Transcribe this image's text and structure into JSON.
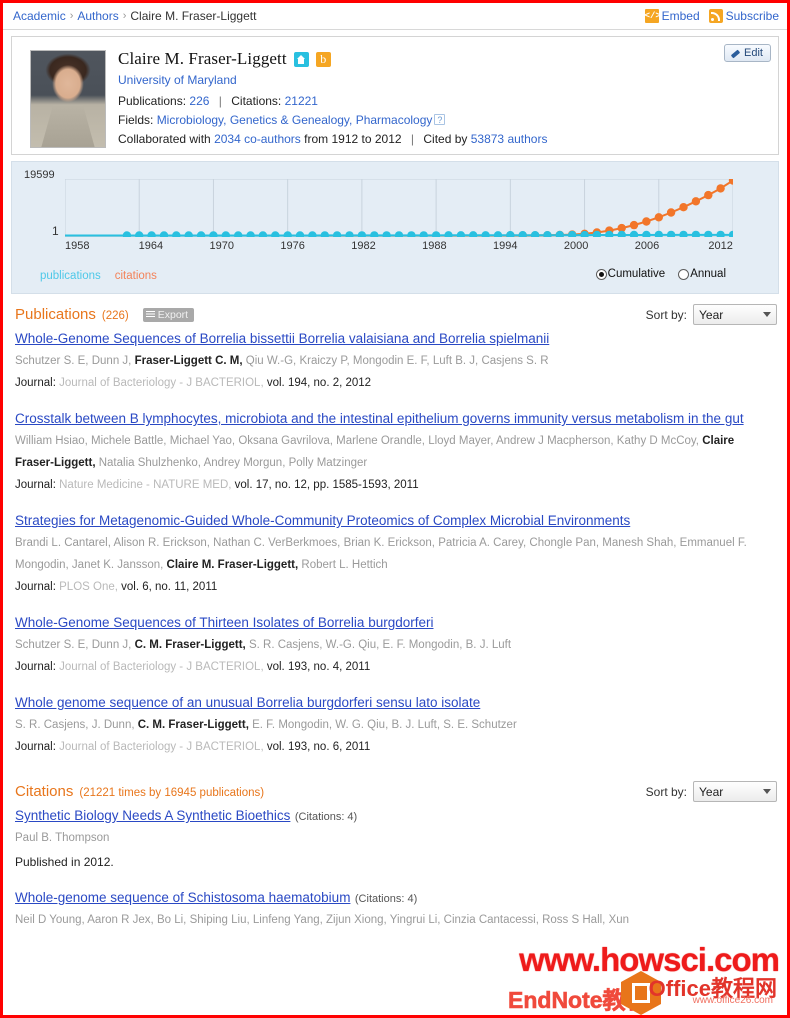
{
  "breadcrumb": {
    "items": [
      "Academic",
      "Authors"
    ],
    "current": "Claire M. Fraser-Liggett",
    "separator": "›"
  },
  "topbar": {
    "embed_label": "Embed",
    "embed_icon": "code-icon",
    "subscribe_label": "Subscribe",
    "subscribe_icon": "rss-icon"
  },
  "profile": {
    "name": "Claire M. Fraser-Liggett",
    "home_icon": "home-icon",
    "bing_icon": "bing-b-icon",
    "affiliation": "University of Maryland",
    "publications_label": "Publications:",
    "publications_count": "226",
    "citations_label": "Citations:",
    "citations_count": "21221",
    "fields_label": "Fields:",
    "fields": [
      "Microbiology,",
      "Genetics & Genealogy,",
      "Pharmacology"
    ],
    "fields_help_icon": "question-mark-icon",
    "collab_prefix": "Collaborated with",
    "collab_link": "2034 co-authors",
    "collab_range": "from 1912 to 2012",
    "cited_prefix": "Cited by",
    "cited_link": "53873 authors",
    "edit_label": "Edit",
    "edit_icon": "pencil-icon",
    "avatar": "author-portrait"
  },
  "chart_data": {
    "type": "line",
    "title": "",
    "xlabel": "",
    "ylabel": "",
    "ylim": [
      1,
      19599
    ],
    "y_tick_labels": [
      "19599",
      "1"
    ],
    "x_tick_labels": [
      "1958",
      "1964",
      "1970",
      "1976",
      "1982",
      "1988",
      "1994",
      "2000",
      "2006",
      "2012"
    ],
    "xlim": [
      1958,
      2012
    ],
    "grid": true,
    "legend_position": "bottom-left",
    "mode_selected": "Cumulative",
    "modes": [
      "Cumulative",
      "Annual"
    ],
    "x": [
      1958,
      1959,
      1960,
      1961,
      1962,
      1963,
      1964,
      1965,
      1966,
      1967,
      1968,
      1969,
      1970,
      1971,
      1972,
      1973,
      1974,
      1975,
      1976,
      1977,
      1978,
      1979,
      1980,
      1981,
      1982,
      1983,
      1984,
      1985,
      1986,
      1987,
      1988,
      1989,
      1990,
      1991,
      1992,
      1993,
      1994,
      1995,
      1996,
      1997,
      1998,
      1999,
      2000,
      2001,
      2002,
      2003,
      2004,
      2005,
      2006,
      2007,
      2008,
      2009,
      2010,
      2011,
      2012
    ],
    "series": [
      {
        "name": "publications",
        "color": "#29c0e0",
        "values": [
          0,
          0,
          0,
          0,
          0,
          1,
          1,
          2,
          2,
          3,
          3,
          4,
          5,
          6,
          7,
          8,
          9,
          10,
          12,
          14,
          16,
          18,
          20,
          23,
          26,
          29,
          33,
          37,
          41,
          46,
          51,
          57,
          63,
          70,
          78,
          86,
          95,
          104,
          114,
          124,
          134,
          144,
          154,
          164,
          172,
          180,
          188,
          195,
          202,
          208,
          213,
          218,
          221,
          224,
          226
        ]
      },
      {
        "name": "citations",
        "color": "#f2762a",
        "values": [
          0,
          0,
          0,
          0,
          0,
          0,
          0,
          0,
          0,
          0,
          0,
          0,
          0,
          0,
          0,
          0,
          0,
          0,
          0,
          0,
          0,
          0,
          0,
          0,
          0,
          0,
          0,
          0,
          0,
          0,
          0,
          0,
          0,
          0,
          0,
          0,
          5,
          15,
          35,
          80,
          170,
          330,
          620,
          1080,
          1750,
          2620,
          3700,
          5000,
          6500,
          8200,
          10100,
          12200,
          14400,
          16800,
          19599
        ]
      }
    ],
    "legend": [
      "publications",
      "citations"
    ]
  },
  "publications_section": {
    "title": "Publications",
    "count": "(226)",
    "export_label": "Export",
    "export_icon": "list-lines-icon",
    "sort_label": "Sort by:",
    "sort_value": "Year",
    "sort_options": [
      "Year"
    ],
    "entries": [
      {
        "title": "Whole-Genome Sequences of Borrelia bissettii Borrelia valaisiana and Borrelia spielmanii",
        "authors": [
          {
            "name": "Schutzer S. E,",
            "bold": false
          },
          {
            "name": "Dunn J,",
            "bold": false
          },
          {
            "name": "Fraser-Liggett C. M,",
            "bold": true
          },
          {
            "name": "Qiu W.-G,",
            "bold": false
          },
          {
            "name": "Kraiczy P,",
            "bold": false
          },
          {
            "name": "Mongodin E. F,",
            "bold": false
          },
          {
            "name": "Luft B. J,",
            "bold": false
          },
          {
            "name": "Casjens S. R",
            "bold": false
          }
        ],
        "journal_label": "Journal:",
        "journal_name": "Journal of Bacteriology - J BACTERIOL,",
        "journal_detail": "vol. 194, no. 2, 2012"
      },
      {
        "title": "Crosstalk between B lymphocytes, microbiota and the intestinal epithelium governs immunity versus metabolism in the gut",
        "authors": [
          {
            "name": "William Hsiao,",
            "bold": false
          },
          {
            "name": "Michele Battle,",
            "bold": false
          },
          {
            "name": "Michael Yao,",
            "bold": false
          },
          {
            "name": "Oksana Gavrilova,",
            "bold": false
          },
          {
            "name": "Marlene Orandle,",
            "bold": false
          },
          {
            "name": "Lloyd Mayer,",
            "bold": false
          },
          {
            "name": "Andrew J Macpherson,",
            "bold": false
          },
          {
            "name": "Kathy D McCoy,",
            "bold": false
          },
          {
            "name": "Claire Fraser-Liggett,",
            "bold": true
          },
          {
            "name": "Natalia Shulzhenko,",
            "bold": false
          },
          {
            "name": "Andrey Morgun,",
            "bold": false
          },
          {
            "name": "Polly Matzinger",
            "bold": false
          }
        ],
        "journal_label": "Journal:",
        "journal_name": "Nature Medicine - NATURE MED,",
        "journal_detail": "vol. 17, no. 12, pp. 1585-1593, 2011"
      },
      {
        "title": "Strategies for Metagenomic-Guided Whole-Community Proteomics of Complex Microbial Environments",
        "authors": [
          {
            "name": "Brandi L. Cantarel,",
            "bold": false
          },
          {
            "name": "Alison R. Erickson,",
            "bold": false
          },
          {
            "name": "Nathan C. VerBerkmoes,",
            "bold": false
          },
          {
            "name": "Brian K. Erickson,",
            "bold": false
          },
          {
            "name": "Patricia A. Carey,",
            "bold": false
          },
          {
            "name": "Chongle Pan,",
            "bold": false
          },
          {
            "name": "Manesh Shah,",
            "bold": false
          },
          {
            "name": "Emmanuel F. Mongodin,",
            "bold": false
          },
          {
            "name": "Janet K. Jansson,",
            "bold": false
          },
          {
            "name": "Claire M. Fraser-Liggett,",
            "bold": true
          },
          {
            "name": "Robert L. Hettich",
            "bold": false
          }
        ],
        "journal_label": "Journal:",
        "journal_name": "PLOS One,",
        "journal_detail": "vol. 6, no. 11, 2011"
      },
      {
        "title": "Whole-Genome Sequences of Thirteen Isolates of Borrelia burgdorferi",
        "authors": [
          {
            "name": "Schutzer S. E,",
            "bold": false
          },
          {
            "name": "Dunn J,",
            "bold": false
          },
          {
            "name": "C. M. Fraser-Liggett,",
            "bold": true
          },
          {
            "name": "S. R. Casjens,",
            "bold": false
          },
          {
            "name": "W.-G. Qiu,",
            "bold": false
          },
          {
            "name": "E. F. Mongodin,",
            "bold": false
          },
          {
            "name": "B. J. Luft",
            "bold": false
          }
        ],
        "journal_label": "Journal:",
        "journal_name": "Journal of Bacteriology - J BACTERIOL,",
        "journal_detail": "vol. 193, no. 4, 2011"
      },
      {
        "title": "Whole genome sequence of an unusual Borrelia burgdorferi sensu lato isolate",
        "authors": [
          {
            "name": "S. R. Casjens,",
            "bold": false
          },
          {
            "name": "J. Dunn,",
            "bold": false
          },
          {
            "name": "C. M. Fraser-Liggett,",
            "bold": true
          },
          {
            "name": "E. F. Mongodin,",
            "bold": false
          },
          {
            "name": "W. G. Qiu,",
            "bold": false
          },
          {
            "name": "B. J. Luft,",
            "bold": false
          },
          {
            "name": "S. E. Schutzer",
            "bold": false
          }
        ],
        "journal_label": "Journal:",
        "journal_name": "Journal of Bacteriology - J BACTERIOL,",
        "journal_detail": "vol. 193, no. 6, 2011"
      }
    ]
  },
  "citations_section": {
    "title": "Citations",
    "count": "(21221 times by 16945 publications)",
    "sort_label": "Sort by:",
    "sort_value": "Year",
    "sort_options": [
      "Year"
    ],
    "entries": [
      {
        "title": "Synthetic Biology Needs A Synthetic Bioethics",
        "cited_by": "(Citations: 4)",
        "authors": [
          {
            "name": "Paul B. Thompson",
            "bold": false
          }
        ],
        "published": "Published in 2012."
      },
      {
        "title": "Whole-genome sequence of Schistosoma haematobium",
        "cited_by": "(Citations: 4)",
        "authors": [
          {
            "name": "Neil D Young,",
            "bold": false
          },
          {
            "name": "Aaron R Jex,",
            "bold": false
          },
          {
            "name": "Bo Li,",
            "bold": false
          },
          {
            "name": "Shiping Liu,",
            "bold": false
          },
          {
            "name": "Linfeng Yang,",
            "bold": false
          },
          {
            "name": "Zijun Xiong,",
            "bold": false
          },
          {
            "name": "Yingrui Li,",
            "bold": false
          },
          {
            "name": "Cinzia Cantacessi,",
            "bold": false
          },
          {
            "name": "Ross S Hall,",
            "bold": false
          },
          {
            "name": "Xun",
            "bold": false
          }
        ],
        "published": ""
      }
    ]
  },
  "watermark": {
    "line1": "www.howsci.com",
    "line2": "EndNote教程",
    "line3": "Office教程网",
    "line4": "www.office26.com",
    "logo": "office-logo-icon"
  }
}
